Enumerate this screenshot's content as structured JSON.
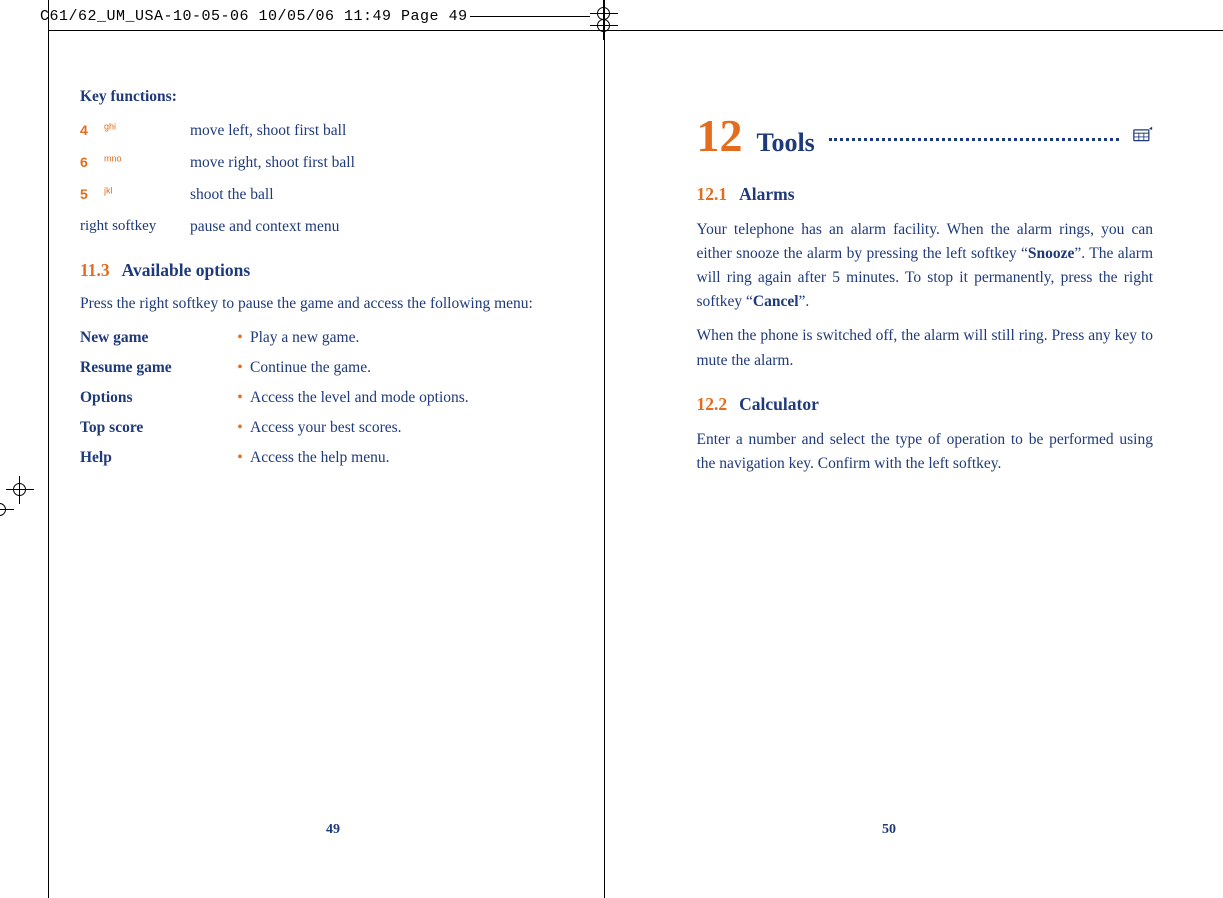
{
  "print_header": "C61/62_UM_USA-10-05-06  10/05/06  11:49  Page 49",
  "left": {
    "kf_title": "Key functions:",
    "keys": [
      {
        "glyph": "4",
        "sup": "ghi",
        "label": "",
        "desc": "move left, shoot first ball"
      },
      {
        "glyph": "6",
        "sup": "mno",
        "label": "",
        "desc": "move right, shoot first ball"
      },
      {
        "glyph": "5",
        "sup": "jkl",
        "label": "",
        "desc": "shoot the ball"
      },
      {
        "glyph": "",
        "sup": "",
        "label": "right softkey",
        "desc": "pause and context menu"
      }
    ],
    "section_num": "11.3",
    "section_title": "Available options",
    "intro": "Press the right softkey to pause the game and access the following menu:",
    "options": [
      {
        "name": "New game",
        "desc": "Play a new game."
      },
      {
        "name": "Resume game",
        "desc": "Continue the game."
      },
      {
        "name": "Options",
        "desc": "Access the level and mode options."
      },
      {
        "name": "Top score",
        "desc": "Access your best scores."
      },
      {
        "name": "Help",
        "desc": "Access the help menu."
      }
    ],
    "page_num": "49"
  },
  "right": {
    "chapter_num": "12",
    "chapter_title": "Tools",
    "s1_num": "12.1",
    "s1_title": "Alarms",
    "s1_p1_a": "Your telephone has an alarm facility. When the alarm rings, you can either snooze the alarm by pressing the left softkey “",
    "s1_p1_b": "Snooze",
    "s1_p1_c": "”. The alarm will ring again after 5 minutes. To stop it permanently, press the right softkey “",
    "s1_p1_d": "Cancel",
    "s1_p1_e": "”.",
    "s1_p2": "When the phone is switched off, the alarm will still ring. Press any key to mute the alarm.",
    "s2_num": "12.2",
    "s2_title": "Calculator",
    "s2_p1": "Enter a number and select the type of operation to be performed using the navigation key. Confirm with the left softkey.",
    "page_num": "50"
  },
  "bullet": "•"
}
